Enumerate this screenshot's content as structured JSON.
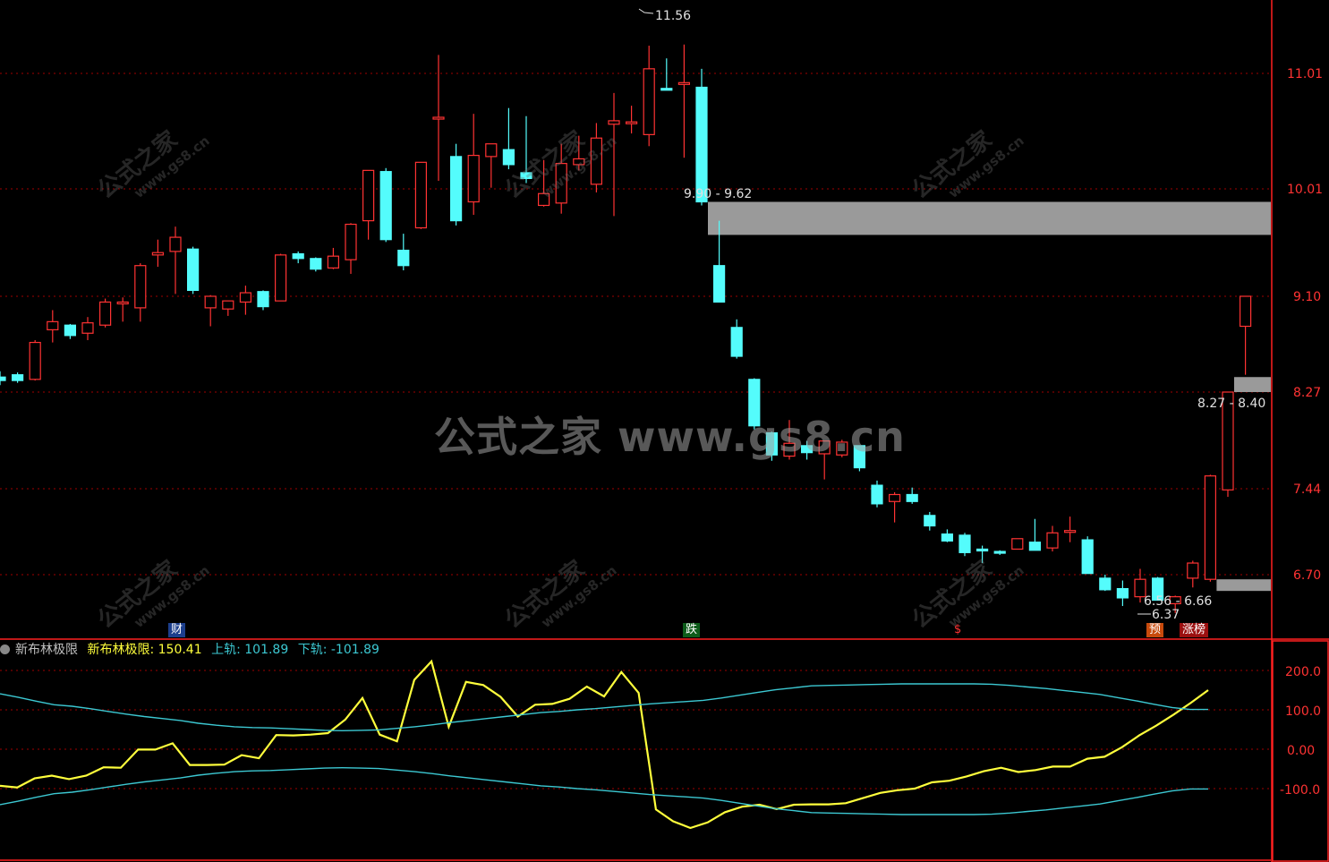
{
  "colors": {
    "up": "#ff3333",
    "down": "#54fcfc",
    "grid": "#a00000",
    "axis": "#ff2020",
    "zone": "#9a9a9a",
    "osc": "#ffff3c",
    "band": "#3cc8d2"
  },
  "watermark": "公式之家 www.gs8.cn",
  "watermark_diag": "公式之家",
  "watermark_diag_url": "www.gs8.cn",
  "main_axis_labels": [
    "11.01",
    "10.01",
    "9.10",
    "8.27",
    "7.44",
    "6.70"
  ],
  "sub_axis_labels": [
    "200.0",
    "100.0",
    "0.00",
    "-100.0"
  ],
  "annotations": {
    "high": "11.56",
    "low": "6.37",
    "zone1": "9.90 - 9.62",
    "zone2": "8.27 - 8.40",
    "zone3": "6.56 - 6.66"
  },
  "signals": {
    "cai": "财",
    "die": "跌",
    "dollar": "$",
    "yu": "预",
    "zhangbang": "涨榜"
  },
  "legend": {
    "name": "新布林极限",
    "main_label": "新布林极限:",
    "main_value": "150.41",
    "upper_label": "上轨:",
    "upper_value": "101.89",
    "lower_label": "下轨:",
    "lower_value": "-101.89"
  },
  "chart_data": [
    {
      "type": "candlestick",
      "y_axis_ticks": [
        11.01,
        10.01,
        9.1,
        8.27,
        7.44,
        6.7
      ],
      "candles": [
        [
          8.4,
          8.45,
          8.33,
          8.37
        ],
        [
          8.42,
          8.44,
          8.35,
          8.37
        ],
        [
          8.38,
          8.72,
          8.37,
          8.7
        ],
        [
          8.81,
          8.98,
          8.7,
          8.88
        ],
        [
          8.85,
          8.86,
          8.73,
          8.76
        ],
        [
          8.78,
          8.92,
          8.72,
          8.87
        ],
        [
          8.85,
          9.08,
          8.83,
          9.05
        ],
        [
          9.05,
          9.09,
          8.88,
          9.05
        ],
        [
          9.0,
          9.38,
          8.88,
          9.36
        ],
        [
          9.45,
          9.58,
          9.35,
          9.47
        ],
        [
          9.48,
          9.69,
          9.12,
          9.6
        ],
        [
          9.5,
          9.52,
          9.12,
          9.15
        ],
        [
          9.0,
          9.11,
          8.84,
          9.1
        ],
        [
          8.99,
          9.03,
          8.93,
          9.06
        ],
        [
          9.05,
          9.19,
          8.94,
          9.13
        ],
        [
          9.14,
          9.15,
          8.98,
          9.01
        ],
        [
          9.06,
          9.46,
          9.06,
          9.45
        ],
        [
          9.46,
          9.48,
          9.38,
          9.42
        ],
        [
          9.42,
          9.43,
          9.31,
          9.33
        ],
        [
          9.34,
          9.51,
          9.33,
          9.44
        ],
        [
          9.41,
          9.72,
          9.29,
          9.71
        ],
        [
          9.74,
          10.17,
          9.58,
          10.17
        ],
        [
          10.16,
          10.19,
          9.56,
          9.58
        ],
        [
          9.49,
          9.63,
          9.32,
          9.36
        ],
        [
          9.68,
          10.23,
          9.67,
          10.24
        ],
        [
          10.63,
          11.17,
          10.08,
          10.63
        ],
        [
          10.29,
          10.4,
          9.7,
          9.74
        ],
        [
          9.9,
          10.66,
          9.79,
          10.3
        ],
        [
          10.29,
          10.33,
          10.02,
          10.4
        ],
        [
          10.35,
          10.71,
          10.18,
          10.22
        ],
        [
          10.15,
          10.64,
          10.06,
          10.1
        ],
        [
          9.87,
          10.26,
          9.86,
          9.97
        ],
        [
          9.89,
          10.4,
          9.8,
          10.23
        ],
        [
          10.22,
          10.47,
          10.17,
          10.27
        ],
        [
          10.05,
          10.58,
          9.98,
          10.45
        ],
        [
          10.57,
          10.84,
          9.78,
          10.6
        ],
        [
          10.59,
          10.73,
          10.49,
          10.59
        ],
        [
          10.48,
          11.25,
          10.38,
          11.05
        ],
        [
          10.88,
          11.14,
          10.87,
          10.87
        ],
        [
          10.92,
          11.26,
          10.28,
          10.93
        ],
        [
          10.89,
          11.05,
          9.87,
          9.9
        ],
        [
          9.36,
          9.74,
          9.18,
          9.05
        ],
        [
          8.83,
          8.9,
          8.56,
          8.58
        ],
        [
          8.38,
          8.39,
          7.95,
          7.98
        ],
        [
          7.92,
          7.93,
          7.68,
          7.73
        ],
        [
          7.72,
          8.03,
          7.69,
          7.83
        ],
        [
          7.81,
          7.85,
          7.69,
          7.75
        ],
        [
          7.74,
          7.84,
          7.52,
          7.85
        ],
        [
          7.73,
          7.86,
          7.71,
          7.84
        ],
        [
          7.81,
          7.81,
          7.59,
          7.62
        ],
        [
          7.47,
          7.51,
          7.28,
          7.31
        ],
        [
          7.33,
          7.41,
          7.15,
          7.39
        ],
        [
          7.39,
          7.45,
          7.31,
          7.33
        ],
        [
          7.21,
          7.24,
          7.08,
          7.12
        ],
        [
          7.05,
          7.09,
          6.98,
          6.99
        ],
        [
          7.04,
          7.06,
          6.86,
          6.89
        ],
        [
          6.92,
          6.95,
          6.8,
          6.91
        ],
        [
          6.9,
          6.91,
          6.87,
          6.89
        ],
        [
          6.92,
          6.99,
          6.94,
          7.01
        ],
        [
          6.98,
          7.18,
          6.91,
          6.91
        ],
        [
          6.93,
          7.12,
          6.9,
          7.06
        ],
        [
          7.07,
          7.2,
          6.98,
          7.08
        ],
        [
          7.0,
          7.03,
          6.71,
          6.71
        ],
        [
          6.67,
          6.7,
          6.56,
          6.57
        ],
        [
          6.58,
          6.65,
          6.43,
          6.5
        ],
        [
          6.51,
          6.75,
          6.46,
          6.66
        ],
        [
          6.67,
          6.68,
          6.48,
          6.48
        ],
        [
          6.45,
          6.52,
          6.37,
          6.51
        ],
        [
          6.67,
          6.82,
          6.59,
          6.8
        ],
        [
          6.66,
          7.56,
          6.64,
          7.55
        ],
        [
          7.43,
          8.27,
          7.37,
          8.27
        ],
        [
          8.84,
          9.09,
          8.42,
          9.1
        ]
      ],
      "zones": [
        {
          "from_index": 40,
          "high": 9.9,
          "low": 9.62
        },
        {
          "from_index": 70,
          "high": 8.4,
          "low": 8.27
        },
        {
          "from_index": 69,
          "high": 6.66,
          "low": 6.56
        }
      ]
    },
    {
      "type": "line",
      "title": "新布林极限",
      "y_axis_ticks": [
        200,
        100,
        0,
        -100
      ],
      "series": [
        {
          "name": "新布林极限",
          "values": [
            -93,
            -97,
            -74,
            -67,
            -76,
            -67,
            -46,
            -47,
            -1,
            -1,
            15,
            -40,
            -40,
            -39,
            -15,
            -23,
            36,
            35,
            37,
            41,
            75,
            130,
            37,
            20,
            176,
            223,
            57,
            171,
            163,
            133,
            83,
            113,
            115,
            128,
            159,
            134,
            196,
            143,
            -153,
            -183,
            -200,
            -186,
            -160,
            -146,
            -141,
            -152,
            -141,
            -140,
            -140,
            -137,
            -124,
            -111,
            -104,
            -100,
            -84,
            -80,
            -69,
            -56,
            -47,
            -58,
            -53,
            -44,
            -44,
            -24,
            -19,
            5,
            35,
            60,
            88,
            118,
            150
          ]
        },
        {
          "name": "上轨",
          "values": [
            141,
            132,
            122,
            113,
            109,
            103,
            96,
            89,
            83,
            78,
            73,
            66,
            61,
            57,
            55,
            54,
            52,
            50,
            48,
            47,
            48,
            49,
            53,
            57,
            62,
            68,
            73,
            78,
            83,
            88,
            93,
            96,
            100,
            103,
            107,
            111,
            115,
            118,
            121,
            124,
            130,
            137,
            144,
            151,
            156,
            161,
            162,
            163,
            164,
            165,
            166,
            166,
            166,
            166,
            166,
            165,
            162,
            158,
            154,
            149,
            144,
            139,
            131,
            123,
            114,
            106,
            101,
            101
          ]
        },
        {
          "name": "下轨",
          "values": [
            -141,
            -132,
            -122,
            -113,
            -109,
            -103,
            -96,
            -89,
            -83,
            -78,
            -73,
            -66,
            -61,
            -57,
            -55,
            -54,
            -52,
            -50,
            -48,
            -47,
            -48,
            -49,
            -53,
            -57,
            -62,
            -68,
            -73,
            -78,
            -83,
            -88,
            -93,
            -96,
            -100,
            -103,
            -107,
            -111,
            -115,
            -118,
            -121,
            -124,
            -130,
            -137,
            -144,
            -151,
            -156,
            -161,
            -162,
            -163,
            -164,
            -165,
            -166,
            -166,
            -166,
            -166,
            -166,
            -165,
            -162,
            -158,
            -154,
            -149,
            -144,
            -139,
            -131,
            -123,
            -114,
            -106,
            -101,
            -101
          ]
        }
      ]
    }
  ]
}
